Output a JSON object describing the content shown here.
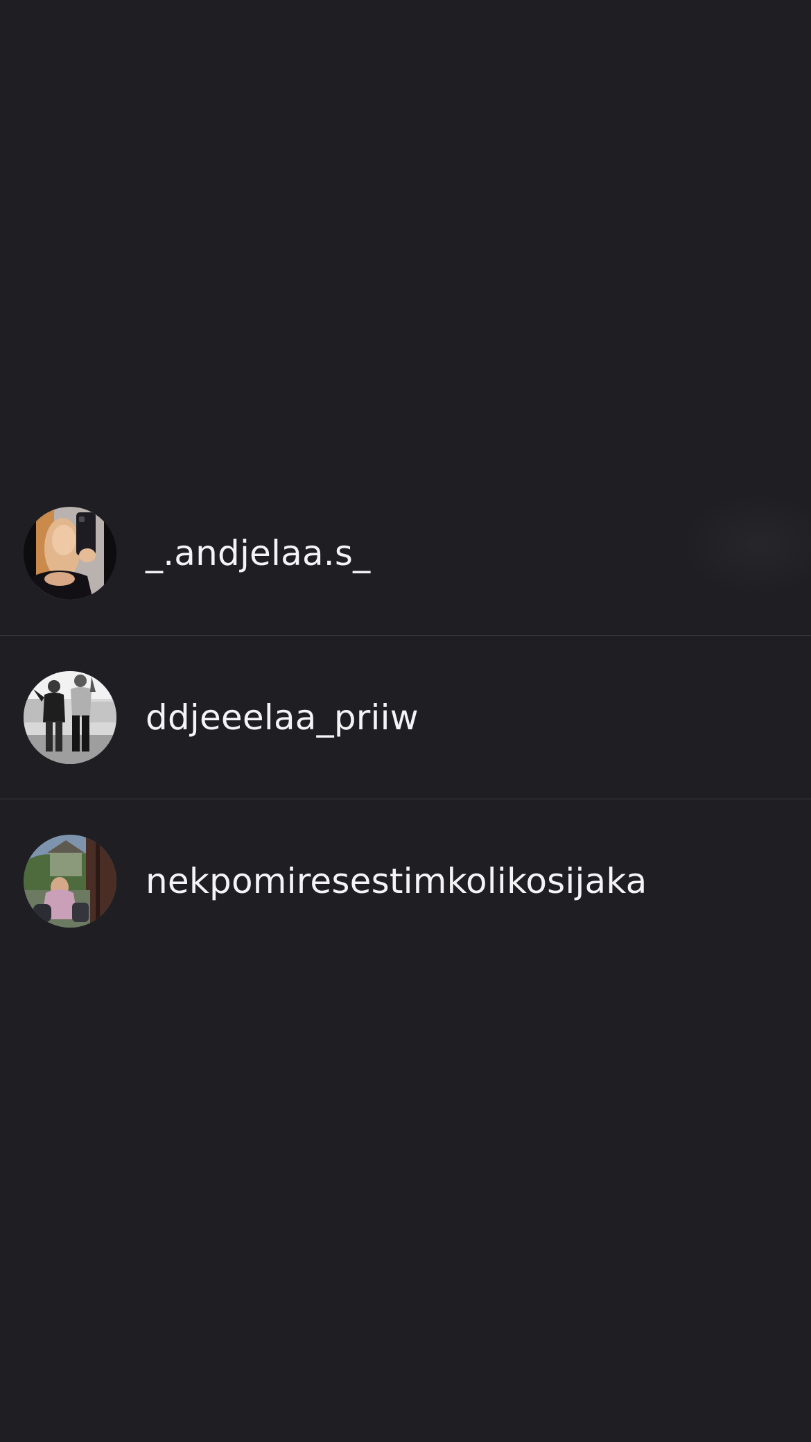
{
  "users": [
    {
      "username": "_.andjelaa.s_",
      "avatar": "profile-photo-mirror-selfie"
    },
    {
      "username": "ddjeeelaa_priiw",
      "avatar": "profile-photo-black-and-white-duo"
    },
    {
      "username": "nekpomiresestimkolikosijaka",
      "avatar": "profile-photo-outdoor"
    }
  ],
  "colors": {
    "background": "#1f1e23",
    "divider": "#3a3940",
    "text": "#f4f4f6"
  }
}
